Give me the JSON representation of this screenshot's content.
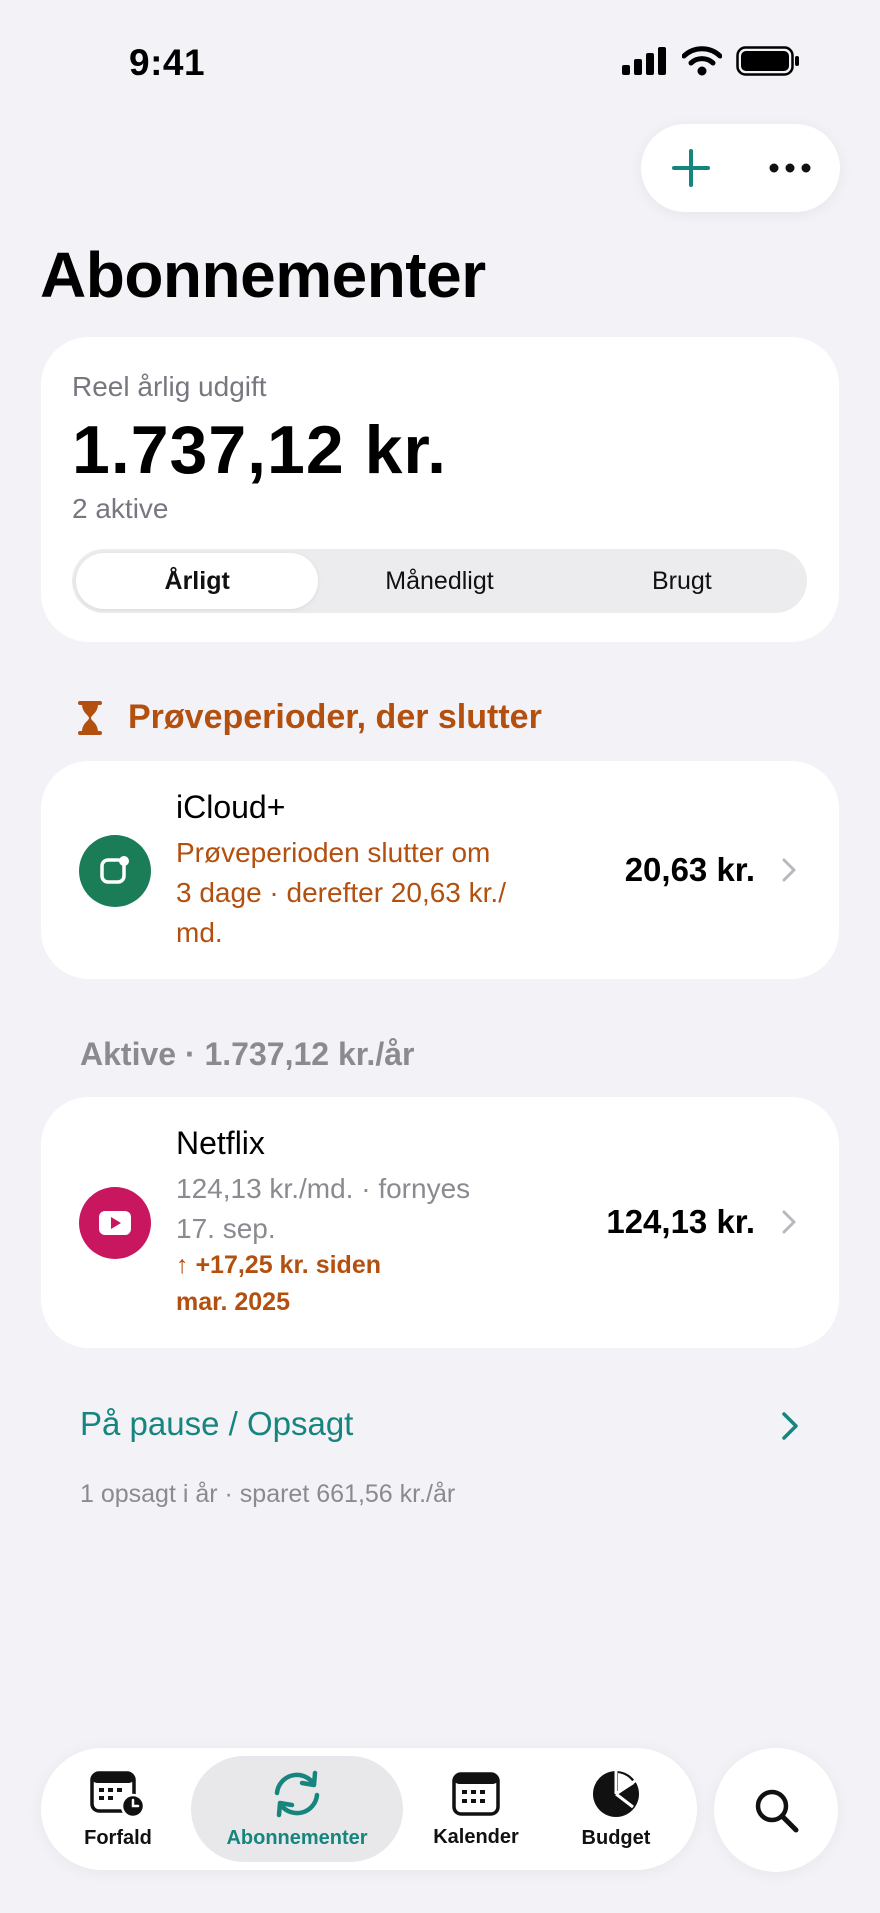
{
  "status_bar": {
    "time": "9:41"
  },
  "header": {
    "title": "Abonnementer",
    "actions": {
      "add_icon": "plus-icon",
      "more_icon": "ellipsis-icon"
    }
  },
  "summary": {
    "label": "Reel årlig udgift",
    "amount": "1.737,12 kr.",
    "active_count": "2 aktive",
    "segments": [
      "Årligt",
      "Månedligt",
      "Brugt"
    ],
    "selected_segment": "Årligt"
  },
  "trials": {
    "heading": "Prøveperioder, der slutter",
    "heading_icon": "hourglass-icon",
    "items": [
      {
        "name": "iCloud+",
        "subtitle_lines": [
          "Prøveperioden slutter om",
          "3 dage · derefter 20,63 kr./",
          "md."
        ],
        "price": "20,63 kr.",
        "icon": "icloud-icon",
        "icon_color": "#1a7d57"
      }
    ]
  },
  "active": {
    "heading": "Aktive · 1.737,12 kr./år",
    "items": [
      {
        "name": "Netflix",
        "subtitle_lines": [
          "124,13 kr./md. · fornyes",
          "17. sep."
        ],
        "change_lines": [
          "↑ +17,25 kr. siden",
          "mar. 2025"
        ],
        "price": "124,13 kr.",
        "icon": "play-icon",
        "icon_color": "#c8175f"
      }
    ]
  },
  "paused": {
    "link": "På pause / Opsagt",
    "note": "1 opsagt i år · sparet 661,56 kr./år"
  },
  "tabbar": {
    "tabs": [
      {
        "label": "Forfald",
        "icon": "calendar-clock-icon"
      },
      {
        "label": "Abonnementer",
        "icon": "sync-icon"
      },
      {
        "label": "Kalender",
        "icon": "calendar-icon"
      },
      {
        "label": "Budget",
        "icon": "pie-chart-icon"
      }
    ],
    "selected": "Abonnementer",
    "search_icon": "search-icon"
  },
  "colors": {
    "accent": "#16857e",
    "warning": "#b34f0f",
    "background": "#f2f2f7",
    "secondary_text": "#8a8a90"
  }
}
